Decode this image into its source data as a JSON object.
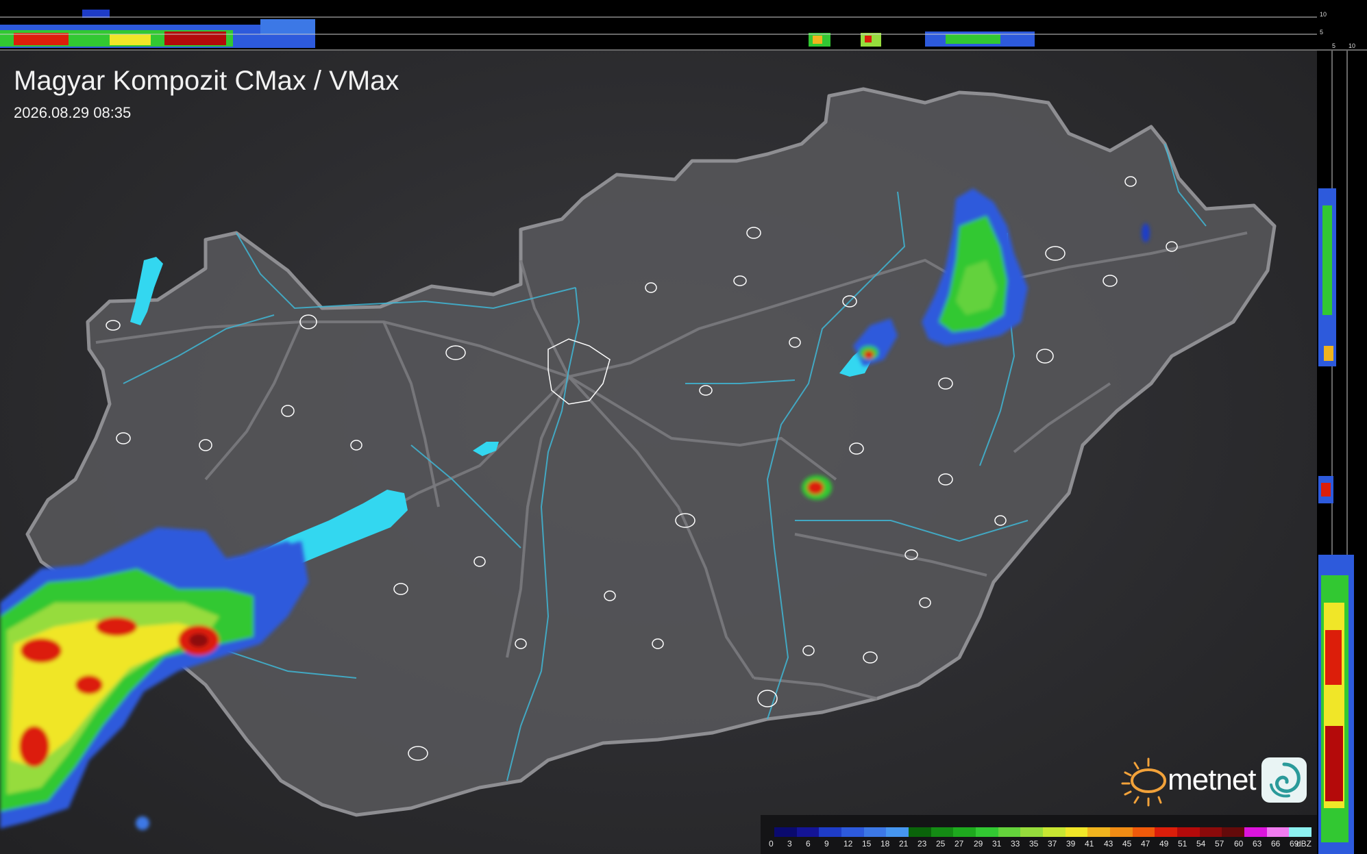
{
  "map_title": "Magyar Kompozit CMax / VMax",
  "timestamp": "2026.08.29 08:35",
  "brand": {
    "name": "metnet"
  },
  "legend": {
    "unit": "dBZ",
    "ticks": [
      "0",
      "3",
      "6",
      "9",
      "12",
      "15",
      "18",
      "21",
      "23",
      "25",
      "27",
      "29",
      "31",
      "33",
      "35",
      "37",
      "39",
      "41",
      "43",
      "45",
      "47",
      "49",
      "51",
      "54",
      "57",
      "60",
      "63",
      "66",
      "69"
    ],
    "colors": [
      "#0a0a6e",
      "#141496",
      "#1e3cc8",
      "#2d5adc",
      "#3c78e6",
      "#4696f0",
      "#0a640a",
      "#148c14",
      "#1eaa1e",
      "#32c832",
      "#64d23c",
      "#96dc3c",
      "#c8e632",
      "#f0e628",
      "#f0b41e",
      "#f08c14",
      "#f05a0a",
      "#dc1e0a",
      "#b40a0a",
      "#8c0a0a",
      "#640a0a",
      "#dc14dc",
      "#f07cf0",
      "#8cf0f0"
    ]
  },
  "profile_scale": {
    "top": [
      "10",
      "5"
    ],
    "side": [
      "5",
      "10"
    ]
  },
  "colors": {
    "country_fill": "#58585c",
    "border": "#8e8e92",
    "roads": "#7a7a7e",
    "rivers": "#3fb7d6",
    "lakes": "#33d7f0",
    "city_outline": "#ffffff"
  }
}
